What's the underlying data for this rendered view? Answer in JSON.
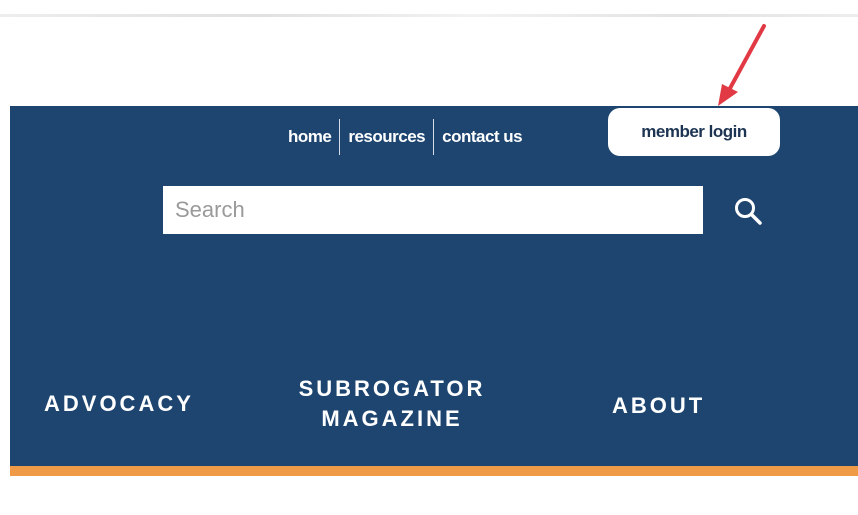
{
  "utility_nav": {
    "items": [
      {
        "label": "home"
      },
      {
        "label": "resources"
      },
      {
        "label": "contact us"
      }
    ],
    "member_login_label": "member login"
  },
  "search": {
    "placeholder": "Search",
    "value": ""
  },
  "main_nav": {
    "advocacy": "ADVOCACY",
    "subrogator_line1": "SUBROGATOR",
    "subrogator_line2": "MAGAZINE",
    "about": "ABOUT"
  },
  "colors": {
    "header_background": "#1d4570",
    "accent_bar": "#ee9a46",
    "annotation_arrow": "#e23a44"
  },
  "icons": {
    "search": "search-icon",
    "annotation": "arrow-annotation-icon"
  }
}
